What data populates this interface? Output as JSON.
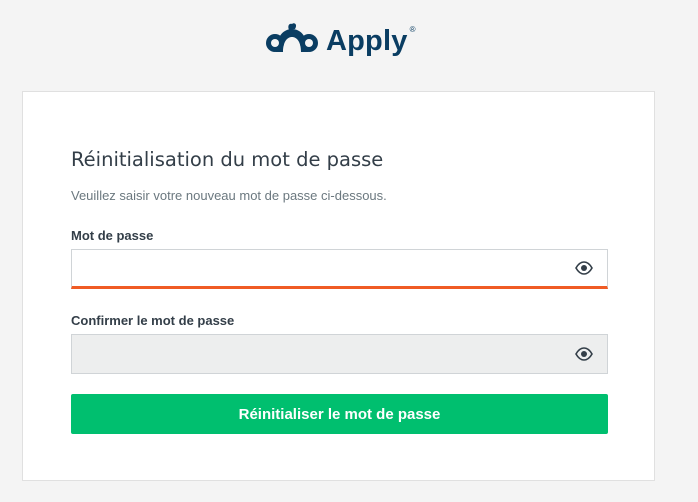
{
  "brand": {
    "name": "Apply",
    "registered": "®",
    "logo_icon": "surveymonkey-logo-icon",
    "color": "#0a3d62"
  },
  "reset": {
    "title": "Réinitialisation du mot de passe",
    "subtitle": "Veuillez saisir votre nouveau mot de passe ci-dessous.",
    "password": {
      "label": "Mot de passe",
      "value": "",
      "placeholder": "",
      "toggle_icon": "eye-icon"
    },
    "confirm": {
      "label": "Confirmer le mot de passe",
      "value": "",
      "placeholder": "",
      "toggle_icon": "eye-icon",
      "disabled": true
    },
    "submit_label": "Réinitialiser le mot de passe"
  },
  "colors": {
    "accent_button": "#00bf6f",
    "focus_underline": "#f05b24",
    "text": "#333e48",
    "muted_text": "#6b787f",
    "page_background": "#f4f4f4"
  }
}
